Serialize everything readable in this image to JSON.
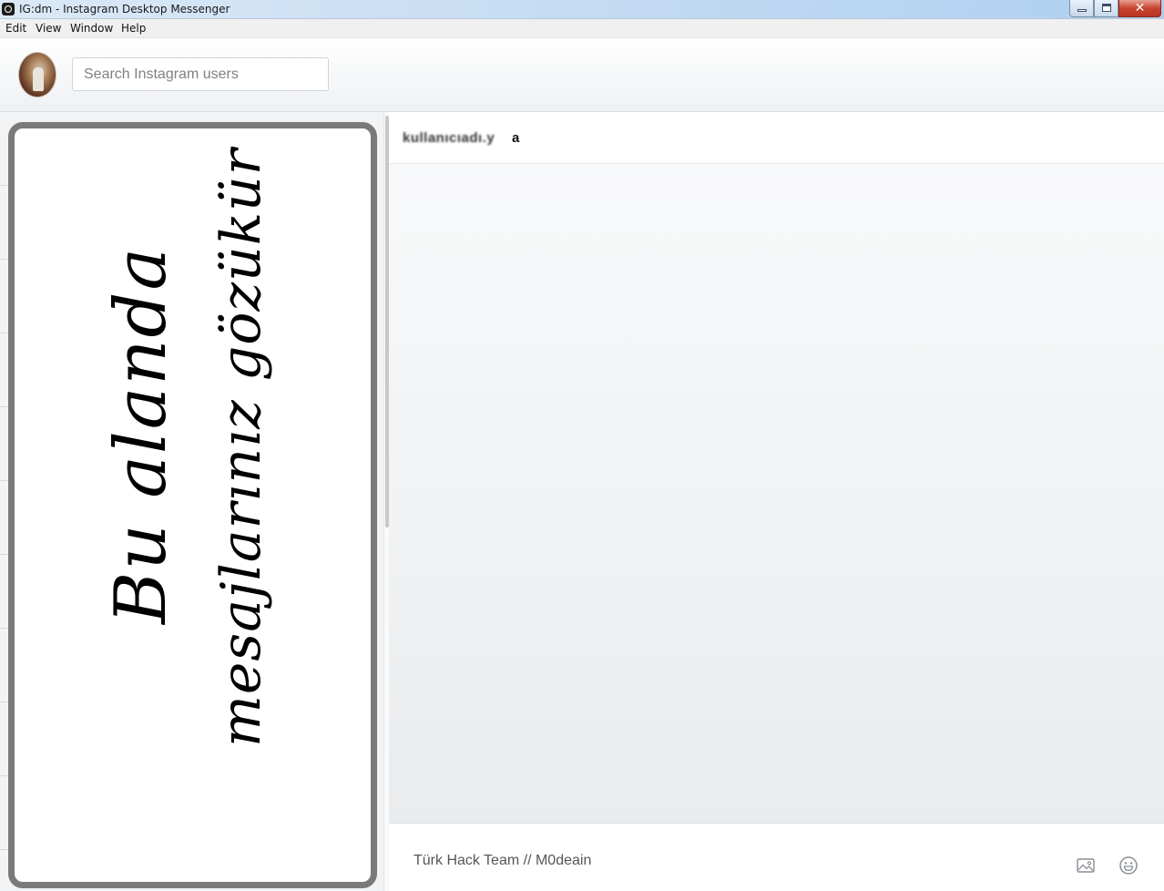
{
  "window": {
    "title": "IG:dm - Instagram Desktop Messenger",
    "close_glyph": "✕"
  },
  "menu": {
    "items": [
      "Edit",
      "View",
      "Window",
      "Help"
    ]
  },
  "header": {
    "search_placeholder": "Search Instagram users"
  },
  "left_panel": {
    "placeholder_line1": "Bu alanda",
    "placeholder_line2": "mesajlarınız gözükür"
  },
  "chat": {
    "title_blurred": "kullanıcıadı.y",
    "title_end": "a",
    "message_input_value": "Türk Hack Team // M0deain"
  },
  "icons": {
    "image": "image-icon",
    "emoji": "smiley-icon"
  }
}
